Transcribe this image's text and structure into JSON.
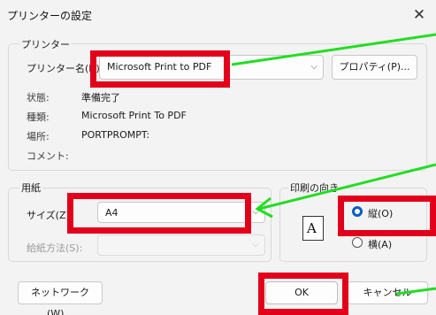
{
  "dialog": {
    "title": "プリンターの設定",
    "close_glyph": "✕"
  },
  "printer": {
    "group_label": "プリンター",
    "name_label": "プリンター名(N):",
    "name_value": "Microsoft Print to PDF",
    "properties_button": "プロパティ(P)...",
    "status_label": "状態:",
    "status_value": "準備完了",
    "type_label": "種類:",
    "type_value": "Microsoft Print To PDF",
    "where_label": "場所:",
    "where_value": "PORTPROMPT:",
    "comment_label": "コメント:"
  },
  "paper": {
    "group_label": "用紙",
    "size_label": "サイズ(Z):",
    "size_value": "A4",
    "source_label": "給紙方法(S):",
    "source_value": ""
  },
  "orientation": {
    "group_label": "印刷の向き",
    "icon_glyph": "A",
    "portrait_label": "縦(O)",
    "landscape_label": "横(A)",
    "selected": "portrait"
  },
  "footer": {
    "network_button": "ネットワーク(W)...",
    "ok_button": "OK",
    "cancel_button": "キャンセル"
  },
  "annotation": {
    "highlight_color": "#e3001b",
    "arrow_color": "#22dd22"
  }
}
